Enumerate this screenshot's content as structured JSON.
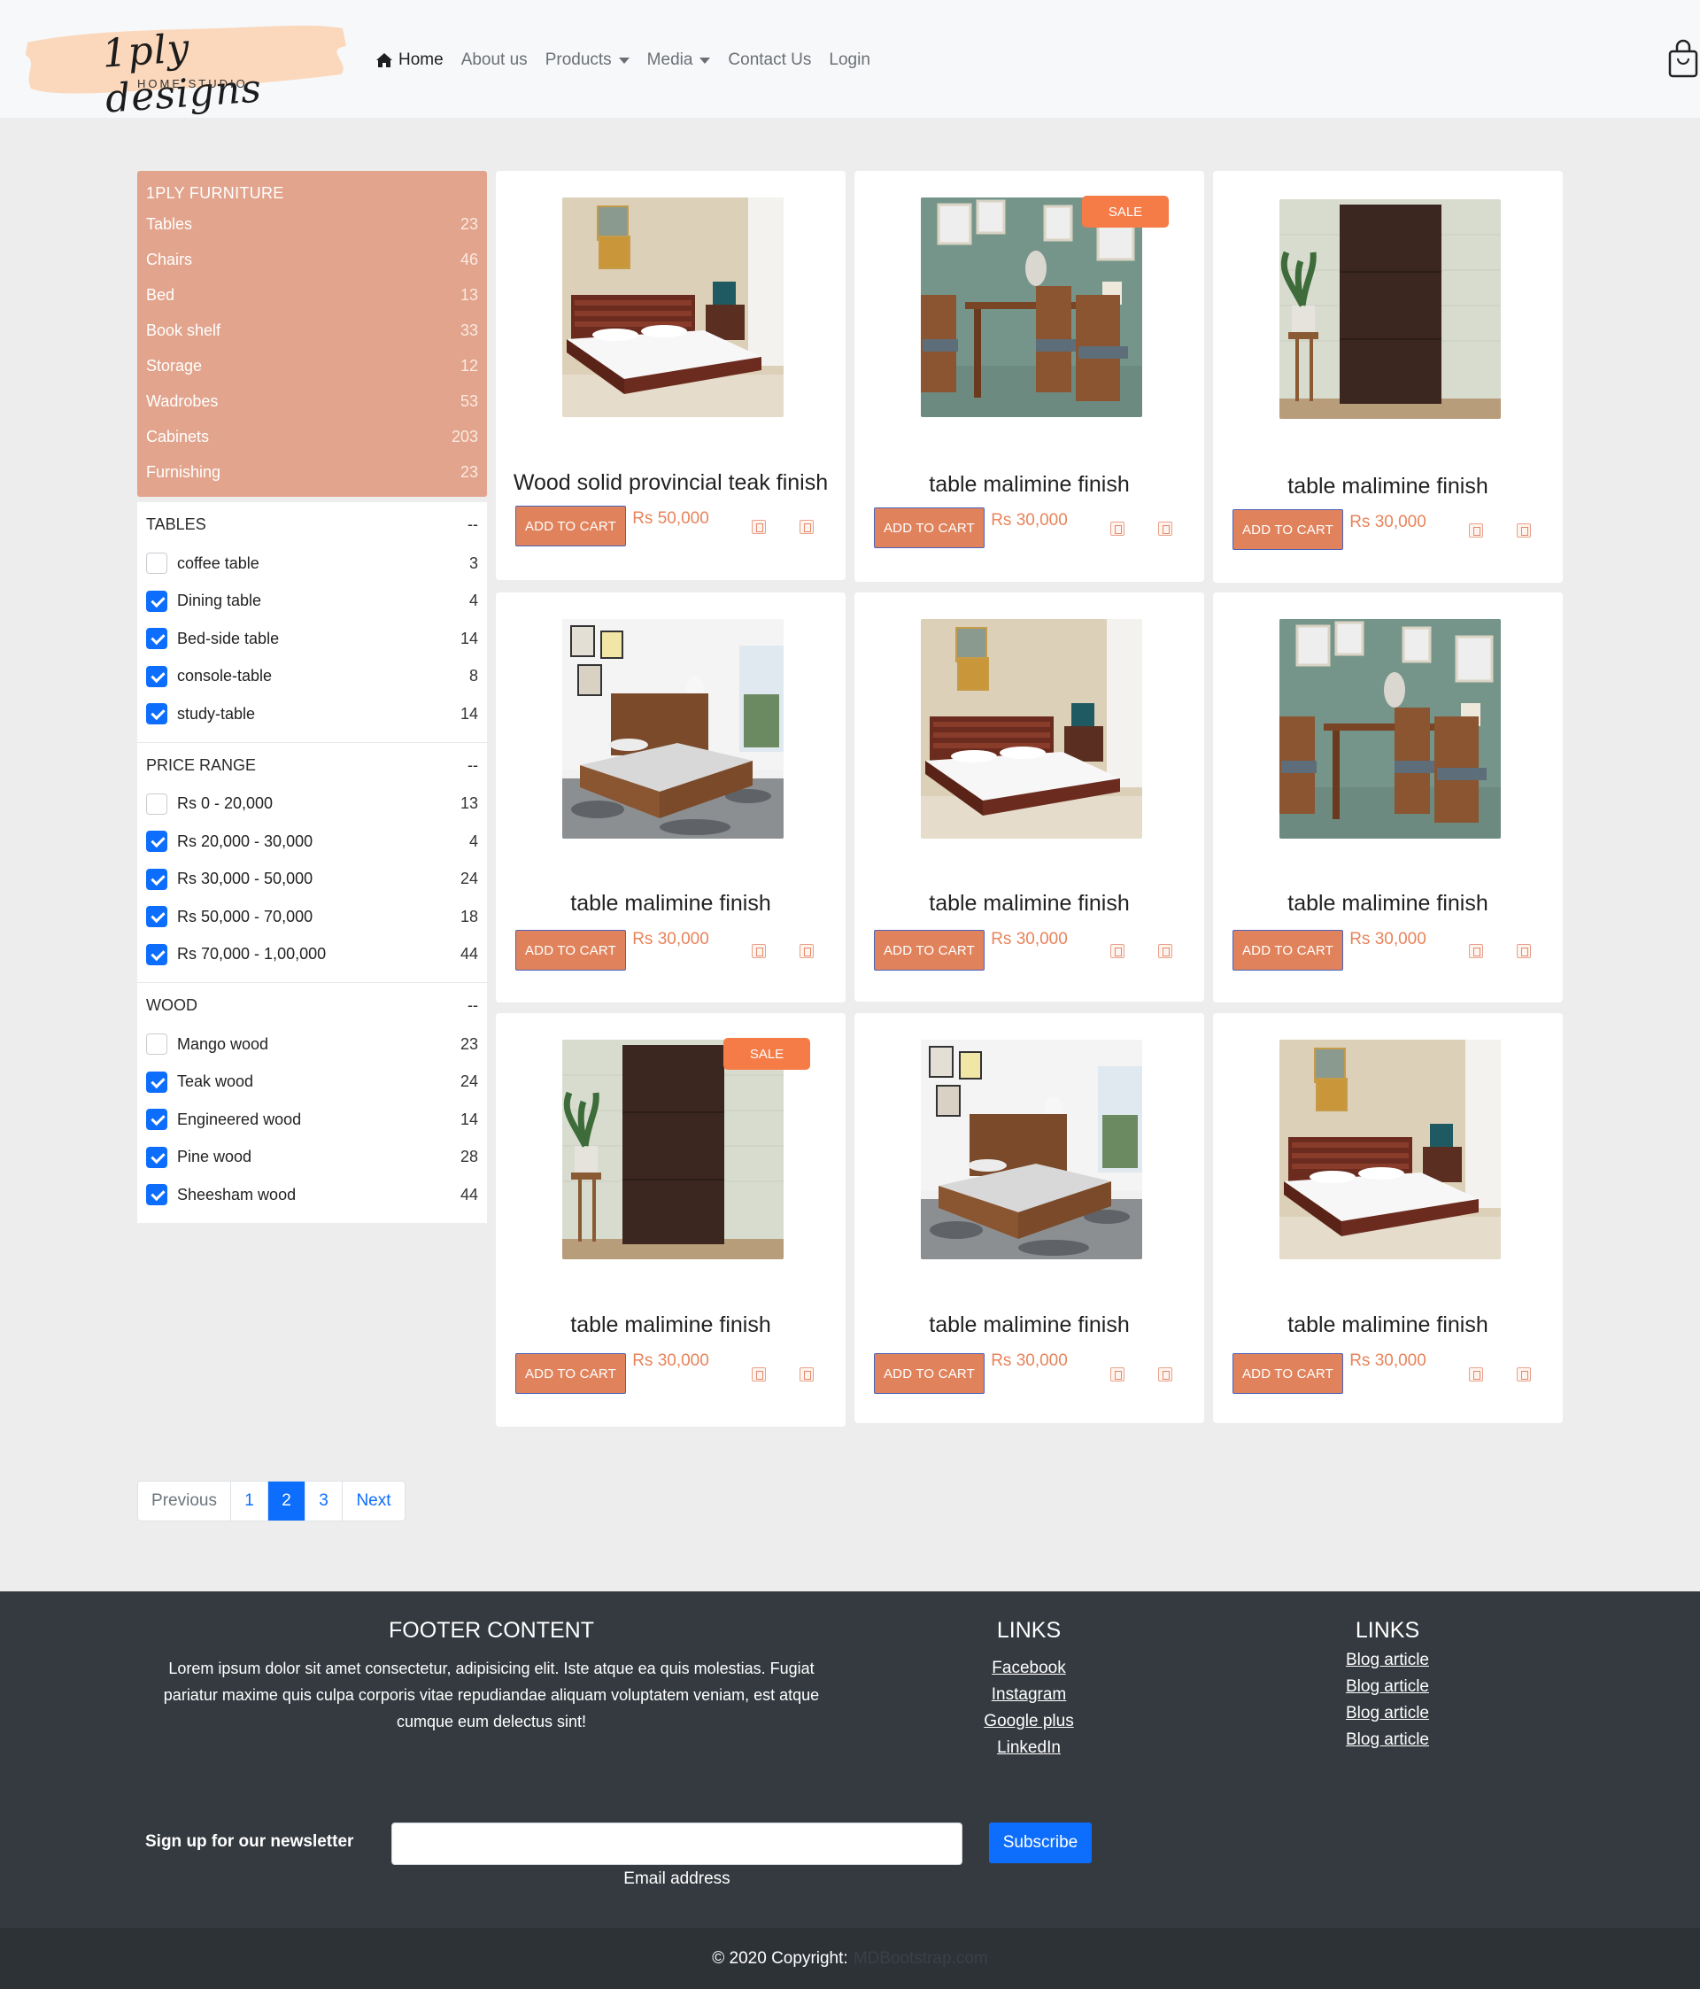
{
  "header": {
    "logo_text": "1ply designs",
    "logo_sub": "HOME STUDIO",
    "nav": [
      {
        "label": "Home",
        "active": true
      },
      {
        "label": "About us"
      },
      {
        "label": "Products",
        "dropdown": true
      },
      {
        "label": "Media",
        "dropdown": true
      },
      {
        "label": "Contact Us"
      },
      {
        "label": "Login"
      }
    ],
    "cart_icon": "shopping-bag-icon"
  },
  "sidebar": {
    "category_title": "1PLY FURNITURE",
    "categories": [
      {
        "label": "Tables",
        "count": "23"
      },
      {
        "label": "Chairs",
        "count": "46"
      },
      {
        "label": "Bed",
        "count": "13"
      },
      {
        "label": "Book shelf",
        "count": "33"
      },
      {
        "label": "Storage",
        "count": "12"
      },
      {
        "label": "Wadrobes",
        "count": "53"
      },
      {
        "label": "Cabinets",
        "count": "203"
      },
      {
        "label": "Furnishing",
        "count": "23"
      }
    ],
    "filters": [
      {
        "title": "TABLES",
        "toggle": "--",
        "options": [
          {
            "label": "coffee table",
            "count": "3",
            "checked": false
          },
          {
            "label": "Dining table",
            "count": "4",
            "checked": true
          },
          {
            "label": "Bed-side table",
            "count": "14",
            "checked": true
          },
          {
            "label": "console-table",
            "count": "8",
            "checked": true
          },
          {
            "label": "study-table",
            "count": "14",
            "checked": true
          }
        ]
      },
      {
        "title": "PRICE RANGE",
        "toggle": "--",
        "options": [
          {
            "label": "Rs 0 - 20,000",
            "count": "13",
            "checked": false
          },
          {
            "label": "Rs 20,000 - 30,000",
            "count": "4",
            "checked": true
          },
          {
            "label": "Rs 30,000 - 50,000",
            "count": "24",
            "checked": true
          },
          {
            "label": "Rs 50,000 - 70,000",
            "count": "18",
            "checked": true
          },
          {
            "label": "Rs 70,000 - 1,00,000",
            "count": "44",
            "checked": true
          }
        ]
      },
      {
        "title": "WOOD",
        "toggle": "--",
        "options": [
          {
            "label": "Mango wood",
            "count": "23",
            "checked": false
          },
          {
            "label": "Teak wood",
            "count": "24",
            "checked": true
          },
          {
            "label": "Engineered wood",
            "count": "14",
            "checked": true
          },
          {
            "label": "Pine wood",
            "count": "28",
            "checked": true
          },
          {
            "label": "Sheesham wood",
            "count": "44",
            "checked": true
          }
        ]
      }
    ]
  },
  "products": [
    {
      "title": "Wood solid provincial teak finish",
      "price": "Rs 50,000",
      "button": "ADD TO CART",
      "image": "bed-slatted",
      "sale": false
    },
    {
      "title": "table malimine finish",
      "price": "Rs 30,000",
      "button": "ADD TO CART",
      "image": "dining",
      "sale": true,
      "sale_label": "SALE"
    },
    {
      "title": "table malimine finish",
      "price": "Rs 30,000",
      "button": "ADD TO CART",
      "image": "wardrobe",
      "sale": false
    },
    {
      "title": "table malimine finish",
      "price": "Rs 30,000",
      "button": "ADD TO CART",
      "image": "bed-white-room",
      "sale": false
    },
    {
      "title": "table malimine finish",
      "price": "Rs 30,000",
      "button": "ADD TO CART",
      "image": "bed-slatted",
      "sale": false
    },
    {
      "title": "table malimine finish",
      "price": "Rs 30,000",
      "button": "ADD TO CART",
      "image": "dining",
      "sale": false
    },
    {
      "title": "table malimine finish",
      "price": "Rs 30,000",
      "button": "ADD TO CART",
      "image": "wardrobe",
      "sale": true,
      "sale_label": "SALE"
    },
    {
      "title": "table malimine finish",
      "price": "Rs 30,000",
      "button": "ADD TO CART",
      "image": "bed-white-room",
      "sale": false
    },
    {
      "title": "table malimine finish",
      "price": "Rs 30,000",
      "button": "ADD TO CART",
      "image": "bed-slatted",
      "sale": false
    }
  ],
  "pagination": {
    "previous": "Previous",
    "pages": [
      "1",
      "2",
      "3"
    ],
    "active": "2",
    "next": "Next"
  },
  "footer": {
    "content_title": "FOOTER CONTENT",
    "content_text": "Lorem ipsum dolor sit amet consectetur, adipisicing elit. Iste atque ea quis molestias. Fugiat pariatur maxime quis culpa corporis vitae repudiandae aliquam voluptatem veniam, est atque cumque eum delectus sint!",
    "links1_title": "LINKS",
    "links1": [
      "Facebook",
      "Instagram",
      "Google plus",
      "LinkedIn"
    ],
    "links2_title": "LINKS",
    "links2": [
      "Blog article",
      "Blog article",
      "Blog article",
      "Blog article"
    ],
    "newsletter_label": "Sign up for our newsletter",
    "email_help": "Email address",
    "subscribe": "Subscribe",
    "copyright": "© 2020 Copyright:",
    "copyright_link": "MDBootstrap.com"
  },
  "colors": {
    "accent": "#e0835c",
    "category_bg": "#e2a48c",
    "primary": "#0d6efd",
    "footer_bg": "#343a40"
  }
}
